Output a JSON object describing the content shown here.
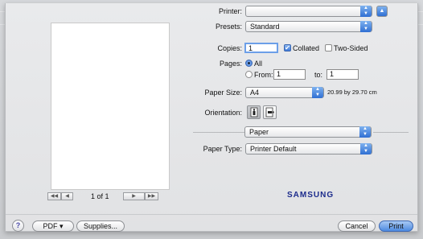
{
  "printer": {
    "label": "Printer:",
    "value": ""
  },
  "presets": {
    "label": "Presets:",
    "value": "Standard"
  },
  "copies": {
    "label": "Copies:",
    "value": "1",
    "collated": "Collated",
    "collated_checked": true,
    "two_sided": "Two-Sided",
    "two_sided_checked": false
  },
  "pages": {
    "label": "Pages:",
    "all": "All",
    "from": "From:",
    "from_value": "1",
    "to": "to:",
    "to_value": "1",
    "selected": "All"
  },
  "paper_size": {
    "label": "Paper Size:",
    "value": "A4",
    "dimensions": "20.99 by 29.70 cm"
  },
  "orientation": {
    "label": "Orientation:",
    "selected": "portrait"
  },
  "section": {
    "value": "Paper"
  },
  "paper_type": {
    "label": "Paper Type:",
    "value": "Printer Default"
  },
  "preview": {
    "page_indicator": "1 of 1",
    "nav": {
      "first": "◀◀",
      "prev": "◀",
      "next": "▶",
      "last": "▶▶"
    }
  },
  "brand": {
    "name": "SAMSUNG",
    "color": "#1c2c8c"
  },
  "footer": {
    "help": "?",
    "pdf": "PDF ▾",
    "supplies": "Supplies...",
    "cancel": "Cancel",
    "print": "Print"
  },
  "icons": {
    "popup_arrows": "updown-arrows-icon",
    "disclosure": "triangle-up-icon"
  }
}
